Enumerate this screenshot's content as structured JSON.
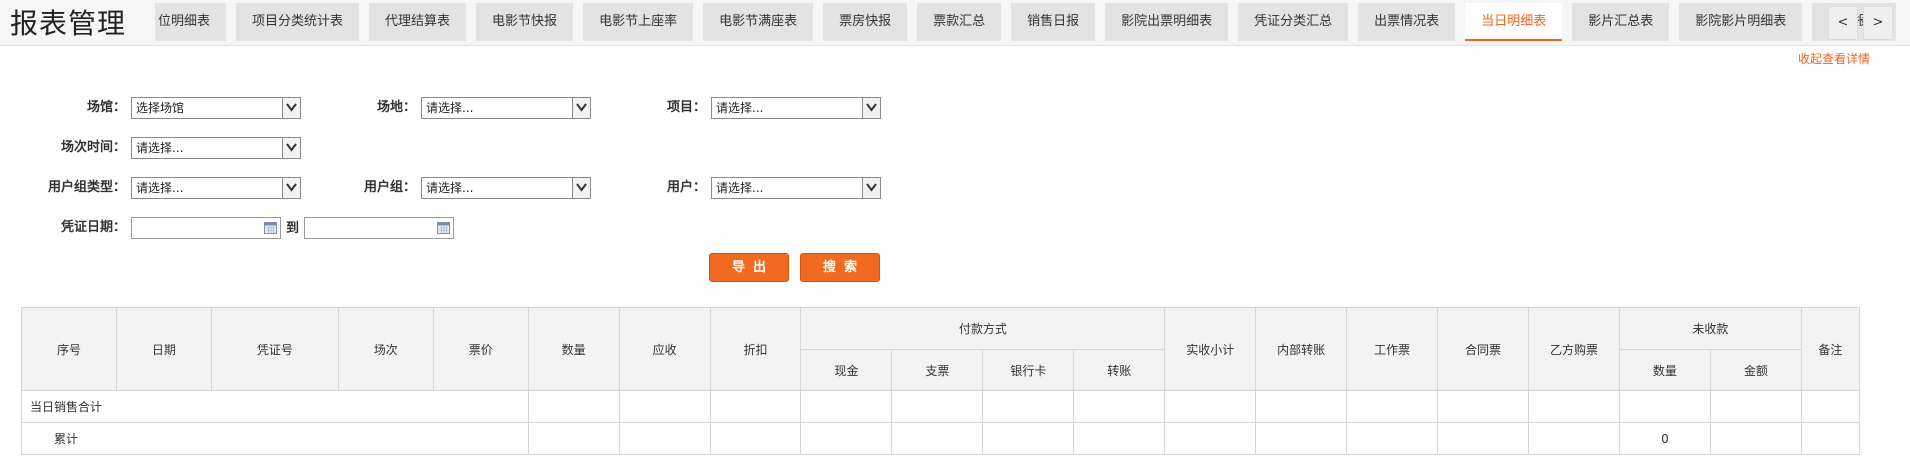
{
  "header": {
    "title": "报表管理",
    "tabs": [
      {
        "label": "位明细表",
        "active": false
      },
      {
        "label": "项目分类统计表",
        "active": false
      },
      {
        "label": "代理结算表",
        "active": false
      },
      {
        "label": "电影节快报",
        "active": false
      },
      {
        "label": "电影节上座率",
        "active": false
      },
      {
        "label": "电影节满座表",
        "active": false
      },
      {
        "label": "票房快报",
        "active": false
      },
      {
        "label": "票款汇总",
        "active": false
      },
      {
        "label": "销售日报",
        "active": false
      },
      {
        "label": "影院出票明细表",
        "active": false
      },
      {
        "label": "凭证分类汇总",
        "active": false
      },
      {
        "label": "出票情况表",
        "active": false
      },
      {
        "label": "当日明细表",
        "active": true
      },
      {
        "label": "影片汇总表",
        "active": false
      },
      {
        "label": "影院影片明细表",
        "active": false
      },
      {
        "label": "动态报表",
        "active": false
      }
    ],
    "prev": "<",
    "next": ">",
    "accent_color": "#f0641e"
  },
  "collapse_link": "收起查看详情",
  "filters": {
    "venue": {
      "label": "场馆：",
      "value": "选择场馆"
    },
    "site": {
      "label": "场地：",
      "value": "请选择..."
    },
    "project": {
      "label": "项目：",
      "value": "请选择..."
    },
    "session_time": {
      "label": "场次时间：",
      "value": "请选择..."
    },
    "user_group_type": {
      "label": "用户组类型：",
      "value": "请选择..."
    },
    "user_group": {
      "label": "用户组：",
      "value": "请选择..."
    },
    "user": {
      "label": "用户：",
      "value": "请选择..."
    },
    "voucher_date": {
      "label": "凭证日期：",
      "from": "",
      "to_label": "到",
      "to": ""
    }
  },
  "buttons": {
    "export": "导出",
    "search": "搜索"
  },
  "table": {
    "headers": {
      "seq": "序号",
      "date": "日期",
      "voucher_no": "凭证号",
      "session": "场次",
      "price": "票价",
      "quantity": "数量",
      "receivable": "应收",
      "discount": "折扣",
      "payment": "付款方式",
      "cash": "现金",
      "check": "支票",
      "bank_card": "银行卡",
      "transfer": "转账",
      "received_subtotal": "实收小计",
      "internal_transfer": "内部转账",
      "work_ticket": "工作票",
      "contract_ticket": "合同票",
      "party_b_purchase": "乙方购票",
      "unpaid": "未收款",
      "unpaid_qty": "数量",
      "unpaid_amount": "金额",
      "remarks": "备注"
    },
    "rows": [
      {
        "label": "当日销售合计",
        "unpaid_qty": ""
      },
      {
        "label": "累计",
        "unpaid_qty": "0"
      }
    ]
  }
}
